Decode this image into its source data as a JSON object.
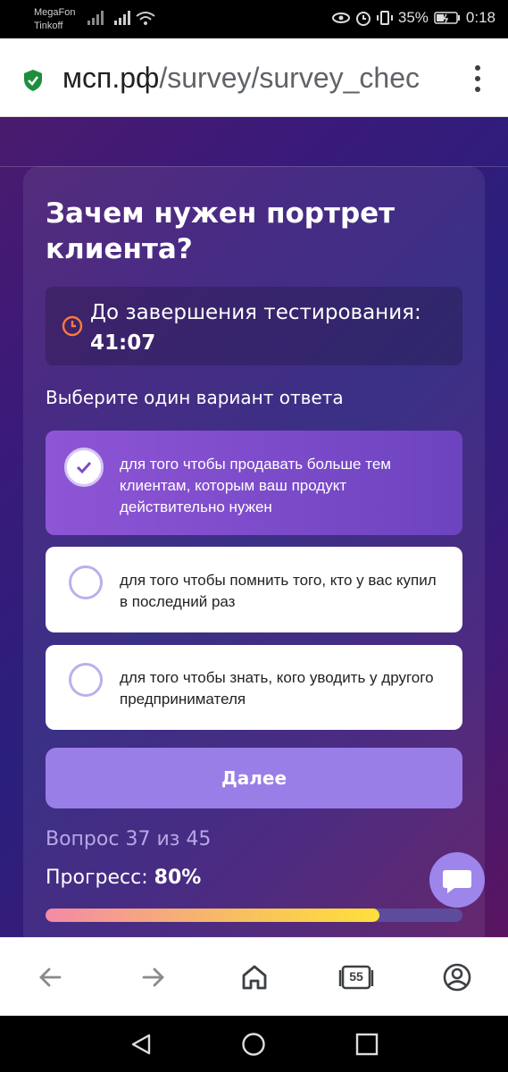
{
  "status_bar": {
    "carrier_1": "MegaFon",
    "carrier_2": "Tinkoff",
    "battery": "35%",
    "time": "0:18"
  },
  "browser": {
    "url_domain": "мсп.рф",
    "url_path": "/survey/survey_chec",
    "tab_count": "55",
    "secure_icon": "shield-check-icon"
  },
  "survey": {
    "title": "Зачем нужен портрет клиента?",
    "timer_label": "До завершения тестирования:",
    "timer_value": "41:07",
    "instruction": "Выберите один вариант ответа",
    "options": [
      {
        "text": "для того чтобы продавать больше тем клиентам, которым ваш продукт действительно нужен",
        "selected": true
      },
      {
        "text": "для того чтобы помнить того, кто у вас купил в последний раз",
        "selected": false
      },
      {
        "text": "для того чтобы знать, кого уводить у другого предпринимателя",
        "selected": false
      }
    ],
    "next_label": "Далее",
    "question_counter": "Вопрос 37 из 45",
    "progress_label": "Прогресс:",
    "progress_value": "80%",
    "progress_fraction": 0.8
  },
  "colors": {
    "accent": "#9a7ee8",
    "selected_option": "#7b4bc9",
    "secure_green": "#1e8e3e"
  }
}
